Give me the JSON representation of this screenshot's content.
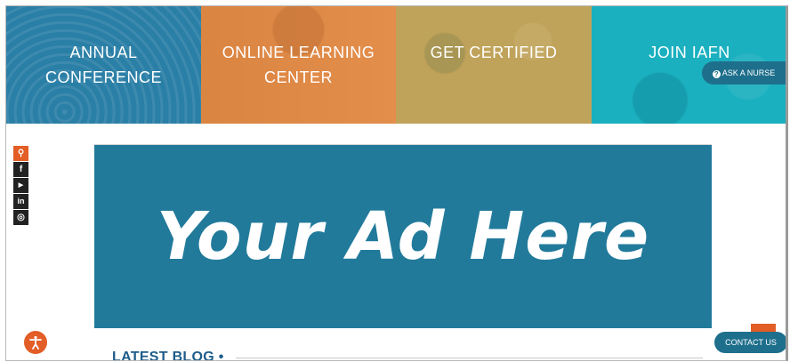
{
  "tiles": [
    {
      "label": "ANNUAL\nCONFERENCE",
      "color": "#2a7fa6"
    },
    {
      "label": "ONLINE LEARNING\nCENTER",
      "color": "#e38a45"
    },
    {
      "label": "GET CERTIFIED",
      "color": "#c0a35a"
    },
    {
      "label": "JOIN IAFN",
      "color": "#1bb0bf"
    }
  ],
  "ask_nurse": {
    "label": "ASK A NURSE",
    "icon": "question-circle-icon"
  },
  "social": [
    {
      "icon": "search-icon",
      "glyph": "⚲"
    },
    {
      "icon": "facebook-icon",
      "glyph": "f"
    },
    {
      "icon": "youtube-icon",
      "glyph": "▶"
    },
    {
      "icon": "linkedin-icon",
      "glyph": "in"
    },
    {
      "icon": "instagram-icon",
      "glyph": "◎"
    }
  ],
  "ad": {
    "text": "Your Ad Here",
    "color": "#227a9b"
  },
  "latest_blog": {
    "title": "LATEST BLOG •"
  },
  "contact": {
    "label": "CONTACT US"
  },
  "colors": {
    "accent_orange": "#e35d26",
    "dark_teal": "#1e6f8c"
  }
}
